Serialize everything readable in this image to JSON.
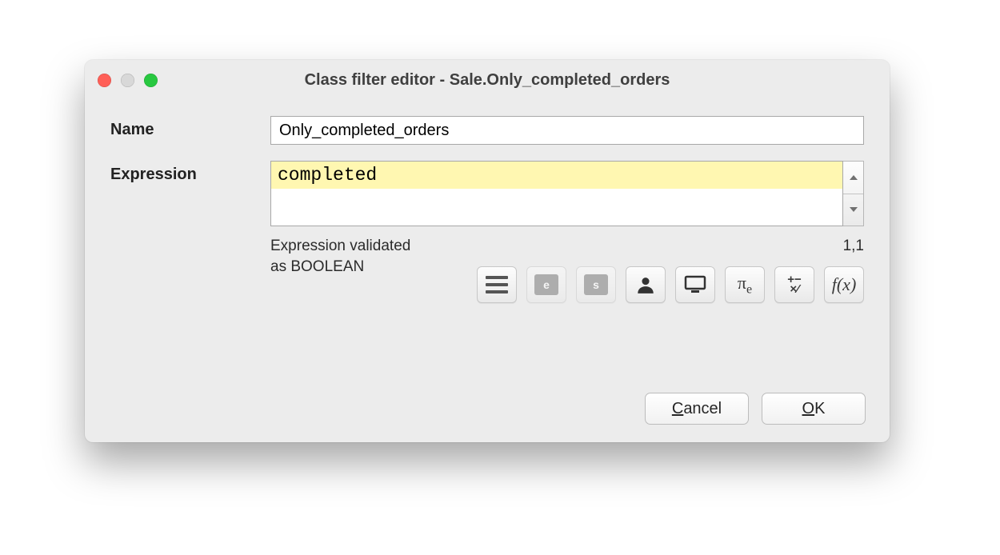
{
  "window": {
    "title": "Class filter editor - Sale.Only_completed_orders"
  },
  "form": {
    "name_label": "Name",
    "name_value": "Only_completed_orders",
    "expression_label": "Expression",
    "expression_value": "completed",
    "status_line1": "Expression validated",
    "status_line2": "as BOOLEAN",
    "caret_position": "1,1"
  },
  "palette": {
    "pi_symbol": "π",
    "pi_sub": "e",
    "ops_top": "+−",
    "ops_bot": "×⁄",
    "fx": "f(x)"
  },
  "buttons": {
    "cancel": "Cancel",
    "ok": "OK"
  }
}
